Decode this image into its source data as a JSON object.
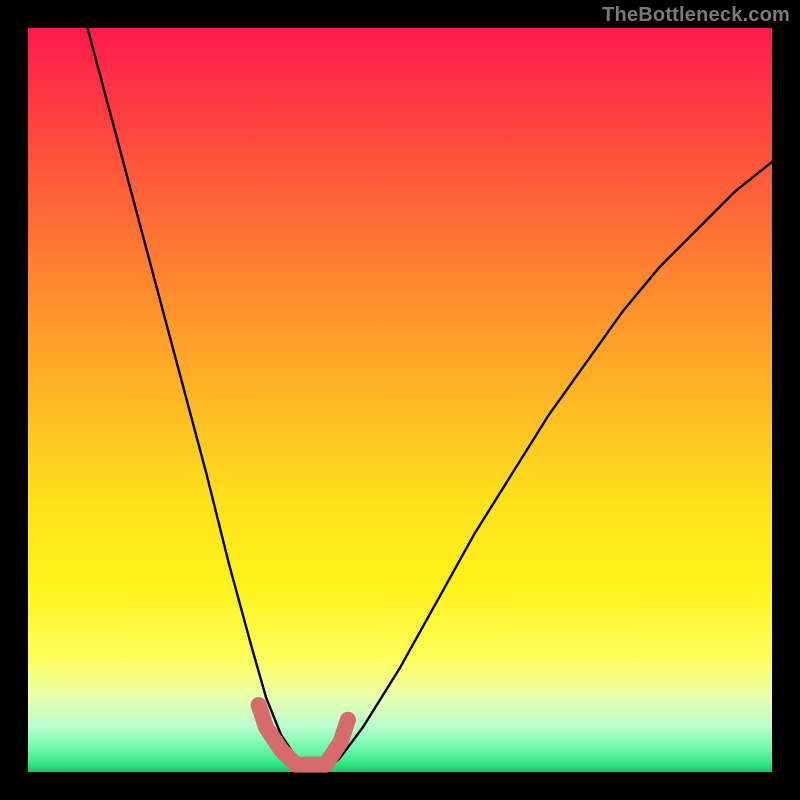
{
  "watermark": "TheBottleneck.com",
  "chart_data": {
    "type": "line",
    "title": "",
    "xlabel": "",
    "ylabel": "",
    "xlim": [
      0,
      100
    ],
    "ylim": [
      0,
      100
    ],
    "grid": false,
    "legend": false,
    "series": [
      {
        "name": "bottleneck-curve",
        "color": "#000000",
        "x": [
          8,
          12,
          16,
          20,
          24,
          27,
          30,
          32,
          34,
          36,
          38,
          40,
          42,
          45,
          50,
          55,
          60,
          65,
          70,
          75,
          80,
          85,
          90,
          95,
          100
        ],
        "y": [
          100,
          85,
          70,
          55,
          40,
          28,
          17,
          10,
          5,
          2,
          0,
          0,
          2,
          6,
          14,
          23,
          32,
          40,
          48,
          55,
          62,
          68,
          73,
          78,
          82
        ]
      },
      {
        "name": "highlight-band",
        "color": "#d76b6b",
        "x": [
          31,
          32,
          34,
          36,
          38,
          40,
          42,
          43
        ],
        "y": [
          9,
          6,
          3,
          1,
          1,
          1,
          4,
          7
        ]
      }
    ],
    "annotations": []
  }
}
